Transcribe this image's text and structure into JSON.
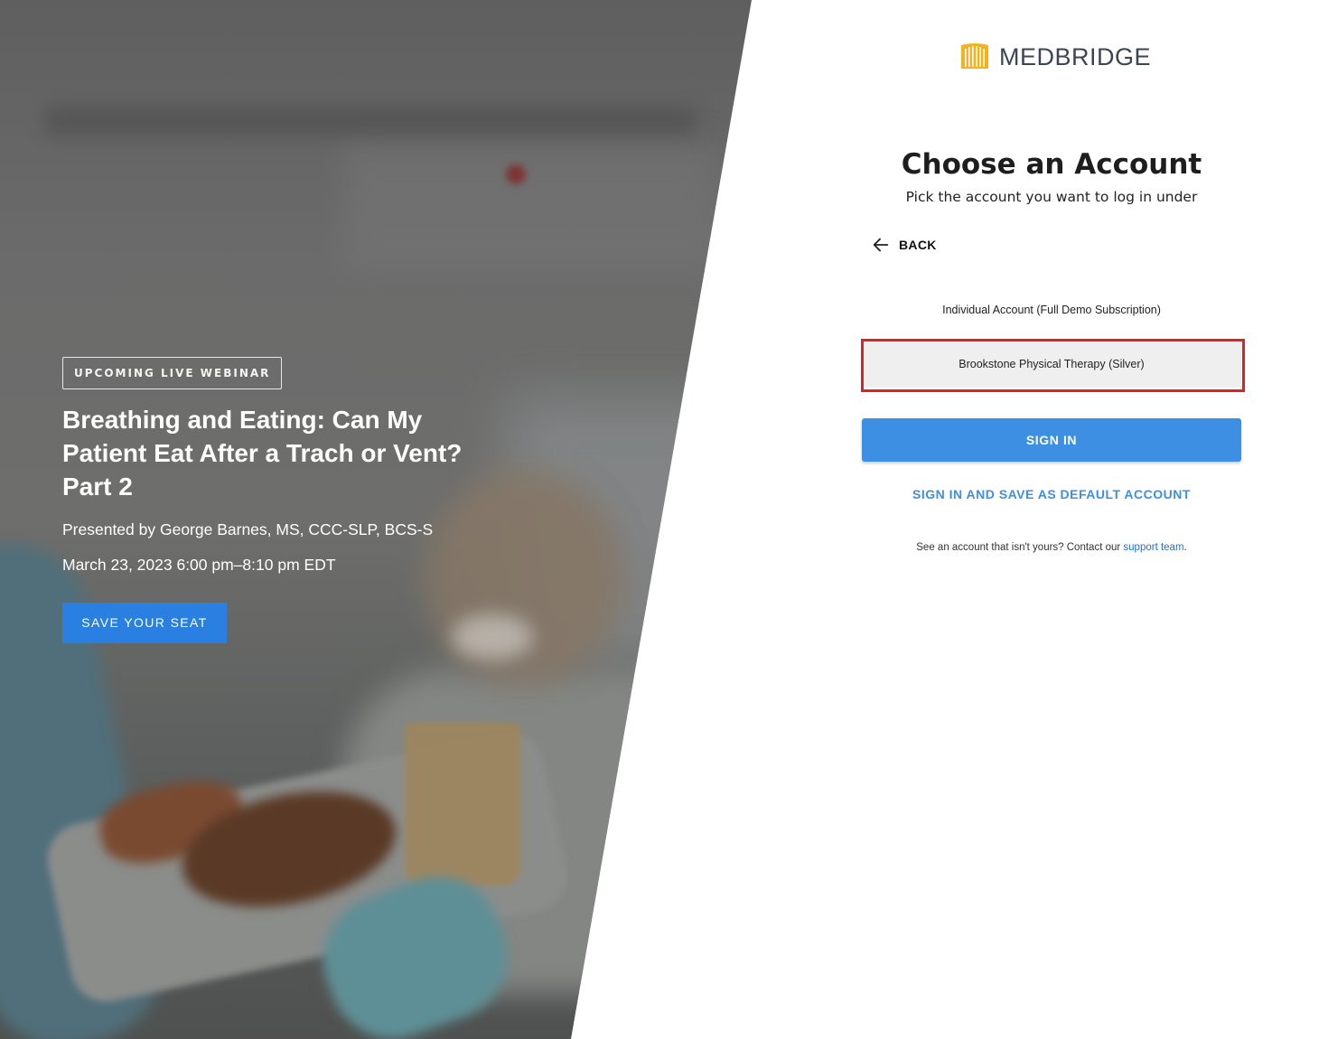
{
  "hero": {
    "badge": "UPCOMING LIVE WEBINAR",
    "title": "Breathing and Eating: Can My Patient Eat After a Trach or Vent? Part 2",
    "presenter": "Presented by George Barnes, MS, CCC-SLP, BCS-S",
    "date": "March 23, 2023 6:00 pm–8:10 pm EDT",
    "cta_label": "SAVE YOUR SEAT"
  },
  "brand": {
    "name": "MEDBRIDGE",
    "logo_icon": "medbridge-logo-icon",
    "logo_color": "#f5b21c"
  },
  "account_chooser": {
    "title": "Choose an Account",
    "subtitle": "Pick the account you want to log in under",
    "back_label": "BACK",
    "accounts": [
      {
        "label": "Individual Account (Full Demo Subscription)",
        "selected": false
      },
      {
        "label": "Brookstone Physical Therapy (Silver)",
        "selected": true
      }
    ],
    "sign_in_label": "SIGN IN",
    "sign_in_default_label": "SIGN IN AND SAVE AS DEFAULT ACCOUNT",
    "notice_text": "See an account that isn't yours? Contact our ",
    "notice_link": "support team",
    "notice_end": "."
  },
  "colors": {
    "primary": "#3d8fe4",
    "hero_cta": "#2a80e0",
    "highlight": "#dc2323",
    "selected_bg": "#efefef"
  }
}
